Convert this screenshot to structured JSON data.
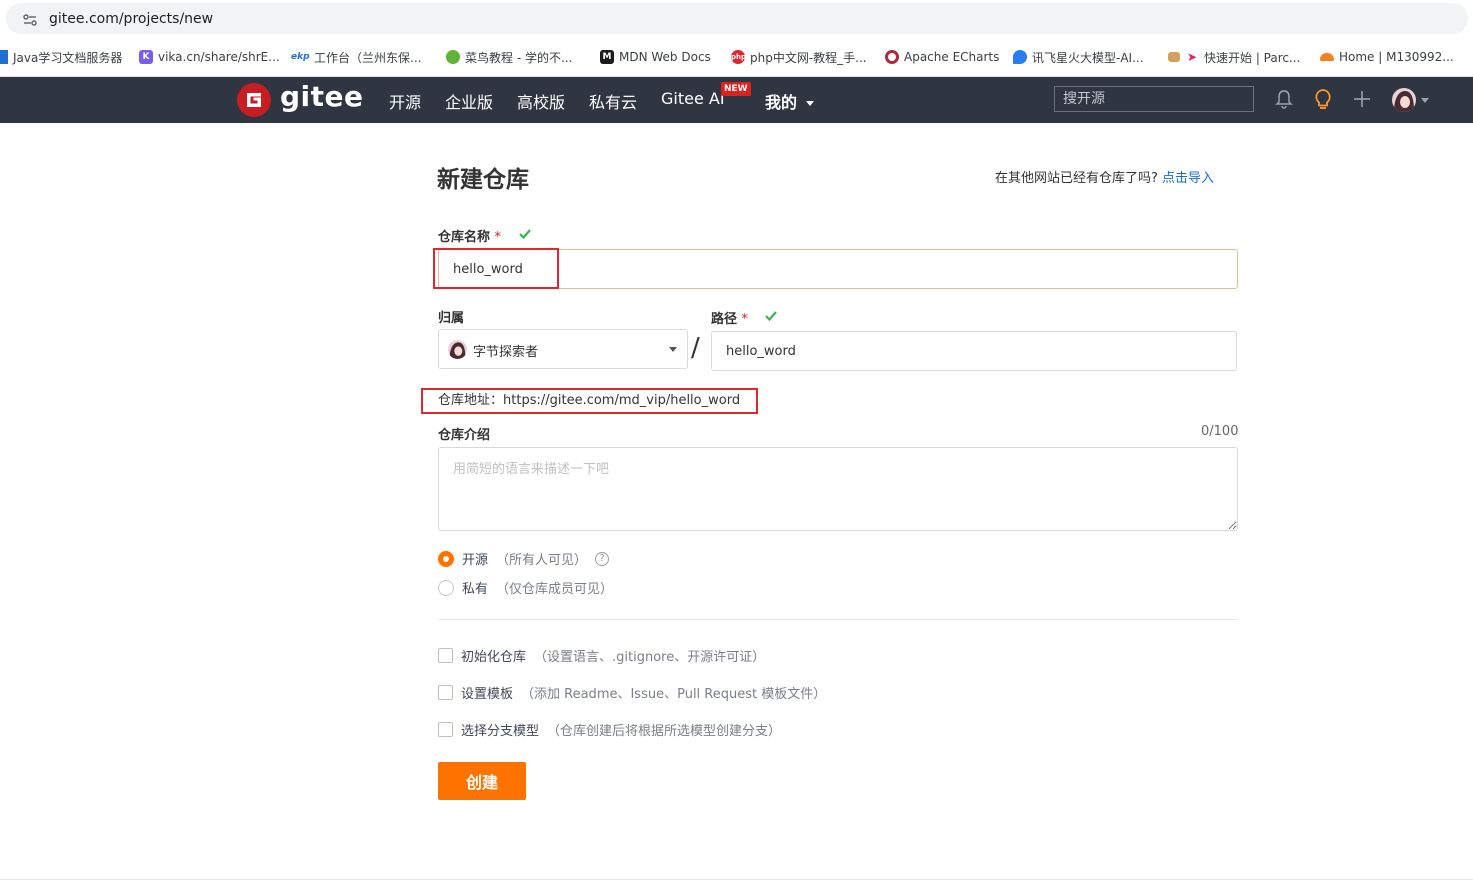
{
  "browser": {
    "url": "gitee.com/projects/new",
    "bookmarks": [
      {
        "label": "Java学习文档服务器",
        "icon": "bookmark-icon",
        "color": "#1f6fd0"
      },
      {
        "label": "vika.cn/share/shrE...",
        "icon": "vika-icon",
        "color": "#7b5cf0"
      },
      {
        "label": "工作台（兰州东保...",
        "icon": "ekp-icon",
        "color": "#1f6fd0"
      },
      {
        "label": "菜鸟教程 - 学的不...",
        "icon": "runoob-icon",
        "color": "#5fb336"
      },
      {
        "label": "MDN Web Docs",
        "icon": "mdn-icon",
        "color": "#1b1b1b"
      },
      {
        "label": "php中文网-教程_手...",
        "icon": "php-icon",
        "color": "#e0262e"
      },
      {
        "label": "Apache ECharts",
        "icon": "echarts-icon",
        "color": "#b0283a"
      },
      {
        "label": "讯飞星火大模型-AI...",
        "icon": "xunfei-icon",
        "color": "#2a7df0"
      },
      {
        "label": "快速开始 | Parc...",
        "icon": "parcel-icon",
        "color": "#d4a15a"
      },
      {
        "label": "Home | M130992...",
        "icon": "cloudflare-icon",
        "color": "#f48120"
      }
    ]
  },
  "header": {
    "logo_text": "gitee",
    "nav": [
      "开源",
      "企业版",
      "高校版",
      "私有云",
      "Gitee AI",
      "我的"
    ],
    "new_badge": "NEW",
    "search_placeholder": "搜开源",
    "colors": {
      "bg": "#2f3541",
      "brand": "#c71d23"
    }
  },
  "form": {
    "title": "新建仓库",
    "import_hint": "在其他网站已经有仓库了吗?",
    "import_link": "点击导入",
    "repo_name_label": "仓库名称",
    "required_mark": "*",
    "repo_name_value": "hello_word",
    "owner_label": "归属",
    "owner_value": "字节探索者",
    "path_label": "路径",
    "path_value": "hello_word",
    "separator": "/",
    "repo_address_label": "仓库地址：",
    "repo_address_value": "https://gitee.com/md_vip/hello_word",
    "desc_label": "仓库介绍",
    "desc_counter": "0/100",
    "desc_placeholder": "用简短的语言来描述一下吧",
    "visibility": [
      {
        "label": "开源",
        "hint": "（所有人可见）",
        "selected": true,
        "help": "?"
      },
      {
        "label": "私有",
        "hint": "（仅仓库成员可见）",
        "selected": false
      }
    ],
    "options": [
      {
        "label": "初始化仓库",
        "hint": "（设置语言、.gitignore、开源许可证）",
        "checked": false
      },
      {
        "label": "设置模板",
        "hint": "（添加 Readme、Issue、Pull Request 模板文件）",
        "checked": false
      },
      {
        "label": "选择分支模型",
        "hint": "（仓库创建后将根据所选模型创建分支）",
        "checked": false
      }
    ],
    "submit_label": "创建",
    "accent_color": "#fe7300",
    "valid_color": "#3bb44a"
  }
}
